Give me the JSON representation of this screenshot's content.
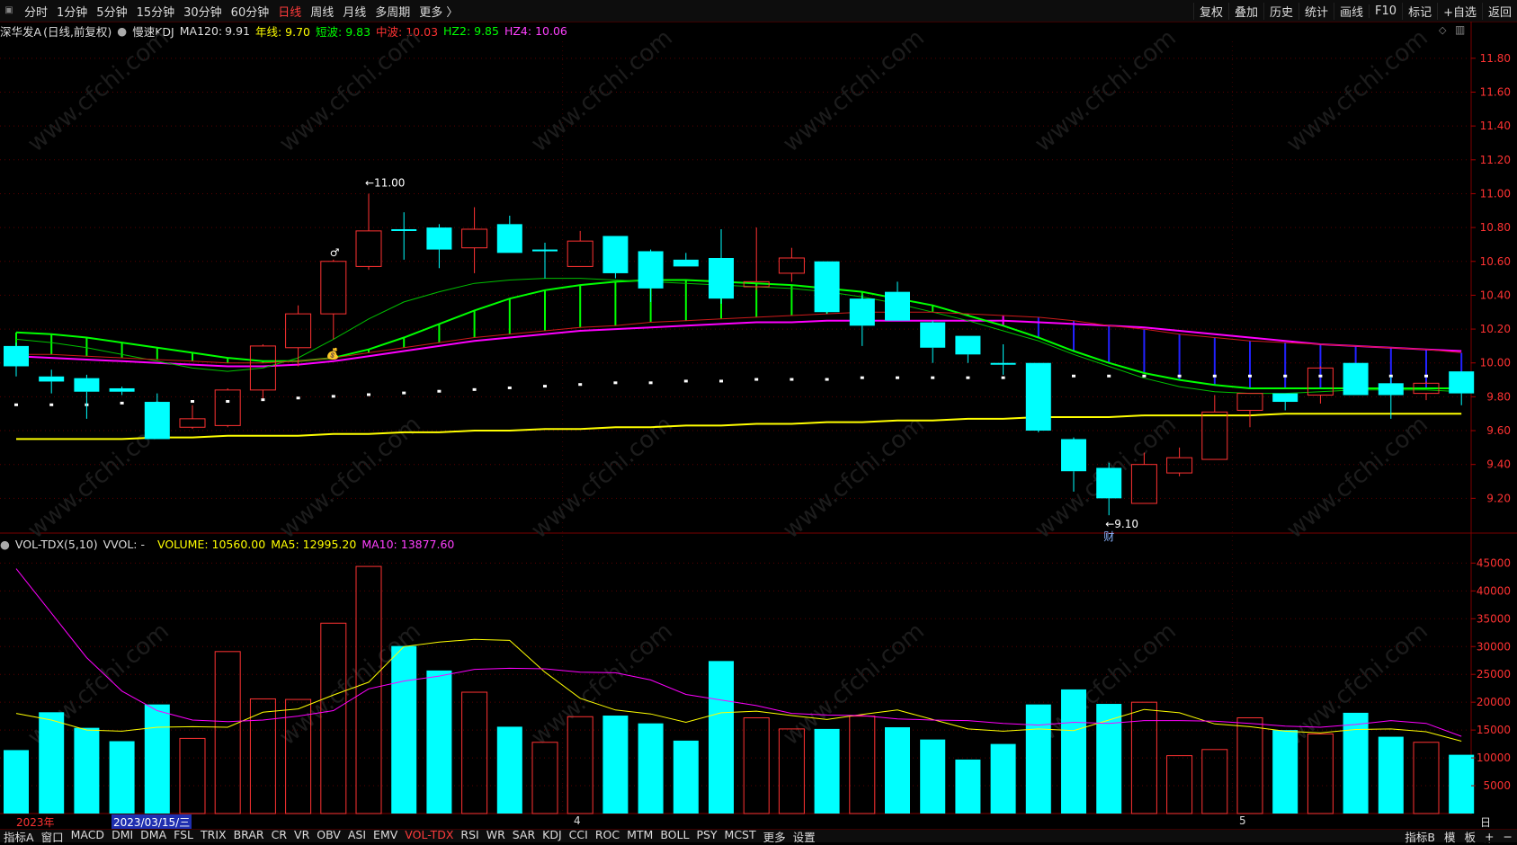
{
  "toolbar": {
    "corner_icon": "restore-icon",
    "periods": [
      "分时",
      "1分钟",
      "5分钟",
      "15分钟",
      "30分钟",
      "60分钟",
      "日线",
      "周线",
      "月线",
      "多周期",
      "更多 〉"
    ],
    "active_period": "日线",
    "tools": [
      "复权",
      "叠加",
      "历史",
      "统计",
      "画线",
      "F10",
      "标记",
      "+自选",
      "返回"
    ]
  },
  "stock_info": {
    "name": "深华发A",
    "mode": "(日线,前复权)",
    "indicator_icon": "circle-icon",
    "indicator": "慢速KDJ",
    "ma120_label": "MA120:",
    "ma120_value": "9.91",
    "nianxian": "年线: 9.70",
    "duanbo": "短波: 9.83",
    "zhongbo": "中波: 10.03",
    "hz2": "HZ2: 9.85",
    "hz4": "HZ4: 10.06",
    "right_icons": [
      "diamond-icon",
      "window-icon"
    ]
  },
  "volume_info": {
    "indicator_icon": "circle-icon",
    "label": "VOL-TDX(5,10)",
    "vvol": "VVOL: -",
    "volume": "VOLUME: 10560.00",
    "ma5": "MA5: 12995.20",
    "ma10": "MA10: 13877.60"
  },
  "colors": {
    "up": "#ff3232",
    "down": "#00ffff",
    "ma_yellow": "#ffff00",
    "ma_green": "#00ff00",
    "ma_magenta": "#ff00ff",
    "price_axis": "#ff3232"
  },
  "chart_data": [
    {
      "type": "candlestick",
      "title": "深华发A 日线",
      "ylim": [
        9.0,
        11.9
      ],
      "yticks": [
        "11.80",
        "11.60",
        "11.40",
        "11.20",
        "11.00",
        "10.80",
        "10.60",
        "10.40",
        "10.20",
        "10.00",
        "9.80",
        "9.60",
        "9.40",
        "9.20"
      ],
      "candles": [
        {
          "o": 10.1,
          "h": 10.12,
          "l": 9.92,
          "c": 9.98
        },
        {
          "o": 9.92,
          "h": 9.96,
          "l": 9.82,
          "c": 9.89
        },
        {
          "o": 9.91,
          "h": 9.93,
          "l": 9.67,
          "c": 9.83
        },
        {
          "o": 9.85,
          "h": 9.86,
          "l": 9.81,
          "c": 9.83
        },
        {
          "o": 9.77,
          "h": 9.82,
          "l": 9.55,
          "c": 9.55
        },
        {
          "o": 9.62,
          "h": 9.75,
          "l": 9.61,
          "c": 9.67
        },
        {
          "o": 9.63,
          "h": 9.85,
          "l": 9.62,
          "c": 9.84
        },
        {
          "o": 9.84,
          "h": 10.11,
          "l": 9.79,
          "c": 10.1
        },
        {
          "o": 10.09,
          "h": 10.34,
          "l": 9.98,
          "c": 10.29
        },
        {
          "o": 10.29,
          "h": 10.61,
          "l": 10.14,
          "c": 10.6
        },
        {
          "o": 10.57,
          "h": 11.0,
          "l": 10.55,
          "c": 10.78
        },
        {
          "o": 10.79,
          "h": 10.89,
          "l": 10.61,
          "c": 10.78
        },
        {
          "o": 10.8,
          "h": 10.82,
          "l": 10.56,
          "c": 10.67
        },
        {
          "o": 10.68,
          "h": 10.92,
          "l": 10.53,
          "c": 10.79
        },
        {
          "o": 10.82,
          "h": 10.87,
          "l": 10.65,
          "c": 10.65
        },
        {
          "o": 10.67,
          "h": 10.71,
          "l": 10.5,
          "c": 10.67
        },
        {
          "o": 10.57,
          "h": 10.78,
          "l": 10.57,
          "c": 10.72
        },
        {
          "o": 10.75,
          "h": 10.75,
          "l": 10.5,
          "c": 10.53
        },
        {
          "o": 10.66,
          "h": 10.67,
          "l": 10.36,
          "c": 10.44
        },
        {
          "o": 10.61,
          "h": 10.65,
          "l": 10.57,
          "c": 10.57
        },
        {
          "o": 10.62,
          "h": 10.79,
          "l": 10.35,
          "c": 10.38
        },
        {
          "o": 10.45,
          "h": 10.8,
          "l": 10.43,
          "c": 10.48
        },
        {
          "o": 10.53,
          "h": 10.68,
          "l": 10.48,
          "c": 10.62
        },
        {
          "o": 10.6,
          "h": 10.6,
          "l": 10.29,
          "c": 10.3
        },
        {
          "o": 10.38,
          "h": 10.4,
          "l": 10.1,
          "c": 10.22
        },
        {
          "o": 10.42,
          "h": 10.48,
          "l": 10.25,
          "c": 10.25
        },
        {
          "o": 10.24,
          "h": 10.25,
          "l": 10.0,
          "c": 10.09
        },
        {
          "o": 10.16,
          "h": 10.16,
          "l": 10.0,
          "c": 10.05
        },
        {
          "o": 10.0,
          "h": 10.11,
          "l": 9.93,
          "c": 9.99
        },
        {
          "o": 10.0,
          "h": 10.0,
          "l": 9.59,
          "c": 9.6
        },
        {
          "o": 9.55,
          "h": 9.56,
          "l": 9.24,
          "c": 9.36
        },
        {
          "o": 9.38,
          "h": 9.41,
          "l": 9.1,
          "c": 9.2
        },
        {
          "o": 9.17,
          "h": 9.47,
          "l": 9.17,
          "c": 9.4
        },
        {
          "o": 9.35,
          "h": 9.5,
          "l": 9.33,
          "c": 9.44
        },
        {
          "o": 9.43,
          "h": 9.81,
          "l": 9.43,
          "c": 9.71
        },
        {
          "o": 9.72,
          "h": 9.82,
          "l": 9.62,
          "c": 9.82
        },
        {
          "o": 9.82,
          "h": 9.82,
          "l": 9.72,
          "c": 9.77
        },
        {
          "o": 9.81,
          "h": 9.98,
          "l": 9.76,
          "c": 9.97
        },
        {
          "o": 10.0,
          "h": 10.0,
          "l": 9.81,
          "c": 9.81
        },
        {
          "o": 9.88,
          "h": 9.92,
          "l": 9.67,
          "c": 9.81
        },
        {
          "o": 9.82,
          "h": 9.89,
          "l": 9.78,
          "c": 9.88
        },
        {
          "o": 9.95,
          "h": 9.95,
          "l": 9.75,
          "c": 9.82
        }
      ],
      "series": [
        {
          "name": "年线",
          "color": "#ffff00",
          "values": [
            9.55,
            9.55,
            9.55,
            9.55,
            9.56,
            9.56,
            9.57,
            9.57,
            9.57,
            9.58,
            9.58,
            9.59,
            9.59,
            9.6,
            9.6,
            9.61,
            9.61,
            9.62,
            9.62,
            9.63,
            9.63,
            9.64,
            9.64,
            9.65,
            9.65,
            9.66,
            9.66,
            9.67,
            9.67,
            9.68,
            9.68,
            9.68,
            9.69,
            9.69,
            9.69,
            9.69,
            9.7,
            9.7,
            9.7,
            9.7,
            9.7,
            9.7
          ]
        },
        {
          "name": "MA120",
          "color": "#ffffff",
          "values": [
            9.75,
            9.75,
            9.75,
            9.76,
            9.76,
            9.77,
            9.77,
            9.78,
            9.79,
            9.8,
            9.81,
            9.82,
            9.83,
            9.84,
            9.85,
            9.86,
            9.87,
            9.88,
            9.88,
            9.89,
            9.89,
            9.9,
            9.9,
            9.9,
            9.91,
            9.91,
            9.91,
            9.91,
            9.91,
            9.91,
            9.92,
            9.92,
            9.92,
            9.92,
            9.92,
            9.92,
            9.92,
            9.92,
            9.92,
            9.92,
            9.92,
            9.91
          ]
        },
        {
          "name": "中波",
          "color": "#ff00ff",
          "values": [
            10.04,
            10.03,
            10.02,
            10.01,
            10.0,
            9.99,
            9.98,
            9.98,
            9.99,
            10.01,
            10.04,
            10.07,
            10.1,
            10.13,
            10.15,
            10.17,
            10.19,
            10.2,
            10.21,
            10.22,
            10.23,
            10.24,
            10.24,
            10.25,
            10.25,
            10.25,
            10.25,
            10.25,
            10.25,
            10.24,
            10.23,
            10.22,
            10.21,
            10.19,
            10.17,
            10.15,
            10.13,
            10.11,
            10.1,
            10.09,
            10.08,
            10.07
          ]
        },
        {
          "name": "短波",
          "color": "#00ff00",
          "values": [
            10.14,
            10.12,
            10.09,
            10.05,
            10.01,
            9.97,
            9.95,
            9.97,
            10.03,
            10.14,
            10.26,
            10.36,
            10.42,
            10.47,
            10.49,
            10.5,
            10.5,
            10.49,
            10.48,
            10.47,
            10.46,
            10.45,
            10.44,
            10.42,
            10.39,
            10.35,
            10.3,
            10.25,
            10.19,
            10.13,
            10.05,
            9.98,
            9.91,
            9.86,
            9.83,
            9.82,
            9.82,
            9.83,
            9.84,
            9.84,
            9.84,
            9.83
          ]
        },
        {
          "name": "HZ2",
          "color": "#00ff00",
          "values": [
            10.18,
            10.17,
            10.15,
            10.12,
            10.09,
            10.06,
            10.03,
            10.01,
            10.01,
            10.03,
            10.08,
            10.15,
            10.23,
            10.31,
            10.38,
            10.43,
            10.46,
            10.48,
            10.49,
            10.49,
            10.48,
            10.47,
            10.46,
            10.44,
            10.42,
            10.38,
            10.34,
            10.28,
            10.22,
            10.15,
            10.07,
            10.0,
            9.94,
            9.9,
            9.87,
            9.85,
            9.85,
            9.85,
            9.85,
            9.85,
            9.85,
            9.85
          ]
        },
        {
          "name": "HZ4",
          "color": "#ff3232",
          "values": [
            10.05,
            10.05,
            10.04,
            10.03,
            10.02,
            10.01,
            10.0,
            10.0,
            10.01,
            10.03,
            10.06,
            10.09,
            10.12,
            10.15,
            10.17,
            10.19,
            10.21,
            10.22,
            10.24,
            10.25,
            10.26,
            10.27,
            10.28,
            10.29,
            10.3,
            10.3,
            10.3,
            10.29,
            10.28,
            10.27,
            10.25,
            10.22,
            10.2,
            10.17,
            10.15,
            10.13,
            10.12,
            10.11,
            10.1,
            10.09,
            10.08,
            10.06
          ]
        }
      ],
      "annotations": [
        {
          "label": "←11.00",
          "index": 10,
          "price": 11.0,
          "position": "above"
        },
        {
          "label": "←9.10",
          "index": 31,
          "price": 9.1,
          "position": "below"
        },
        {
          "label": "财",
          "index": 31,
          "position": "bottom"
        },
        {
          "label": "♂",
          "index": 9,
          "position": "above"
        },
        {
          "label": "💰",
          "index": 9,
          "position": "below"
        }
      ],
      "watermark": "www.cfchi.com"
    },
    {
      "type": "bar",
      "title": "VOL-TDX(5,10)",
      "ylim": [
        0,
        47000
      ],
      "yticks": [
        "45000",
        "40000",
        "35000",
        "30000",
        "25000",
        "20000",
        "15000",
        "10000",
        "5000"
      ],
      "values": [
        11400,
        18200,
        15400,
        13000,
        19600,
        13500,
        29100,
        20600,
        20500,
        34200,
        44400,
        30100,
        25700,
        21800,
        15600,
        12800,
        17400,
        17600,
        16200,
        13100,
        27400,
        17200,
        15200,
        15200,
        17500,
        15500,
        13300,
        9700,
        12500,
        19600,
        22300,
        19700,
        20000,
        10400,
        11500,
        17200,
        15000,
        14300,
        18100,
        13800,
        12800,
        10560
      ],
      "up": [
        false,
        false,
        false,
        false,
        false,
        true,
        true,
        true,
        true,
        true,
        true,
        false,
        false,
        true,
        false,
        true,
        true,
        false,
        false,
        false,
        false,
        true,
        true,
        false,
        true,
        false,
        false,
        false,
        false,
        false,
        false,
        false,
        true,
        true,
        true,
        true,
        false,
        true,
        false,
        false,
        true,
        false
      ],
      "series": [
        {
          "name": "MA5",
          "color": "#ffff00",
          "values": [
            18000,
            16800,
            15000,
            14800,
            15500,
            15600,
            15500,
            18200,
            18800,
            21300,
            23600,
            30000,
            30800,
            31300,
            31100,
            25400,
            20700,
            18600,
            17900,
            16400,
            18100,
            18400,
            17600,
            16900,
            17800,
            18600,
            16900,
            15200,
            14800,
            15200,
            14900,
            16800,
            18700,
            18100,
            16100,
            15600,
            14800,
            14500,
            15100,
            15200,
            14700,
            12995
          ]
        },
        {
          "name": "MA10",
          "color": "#ff00ff",
          "values": [
            44000,
            36000,
            28000,
            22000,
            18500,
            16800,
            16500,
            16800,
            17500,
            18500,
            22400,
            23800,
            24700,
            25900,
            26100,
            26000,
            25400,
            25300,
            24000,
            21400,
            20400,
            19400,
            18000,
            17700,
            17600,
            17000,
            16800,
            16700,
            16200,
            15900,
            16400,
            16200,
            16700,
            16700,
            16600,
            16200,
            15700,
            15500,
            16000,
            16700,
            16200,
            13877
          ]
        }
      ]
    }
  ],
  "date_axis": {
    "year": "2023年",
    "selected": "2023/03/15/三",
    "ticks": [
      "4",
      "5"
    ],
    "period": "日线"
  },
  "bottombar": {
    "indicator_menu": "指标A",
    "window": "窗口",
    "indicators": [
      "MACD",
      "DMI",
      "DMA",
      "FSL",
      "TRIX",
      "BRAR",
      "CR",
      "VR",
      "OBV",
      "ASI",
      "EMV",
      "VOL-TDX",
      "RSI",
      "WR",
      "SAR",
      "KDJ",
      "CCI",
      "ROC",
      "MTM",
      "BOLL",
      "PSY",
      "MCST",
      "更多",
      "设置"
    ],
    "active": "VOL-TDX",
    "right": [
      "指标B",
      "模",
      "板",
      "+",
      "−"
    ]
  }
}
